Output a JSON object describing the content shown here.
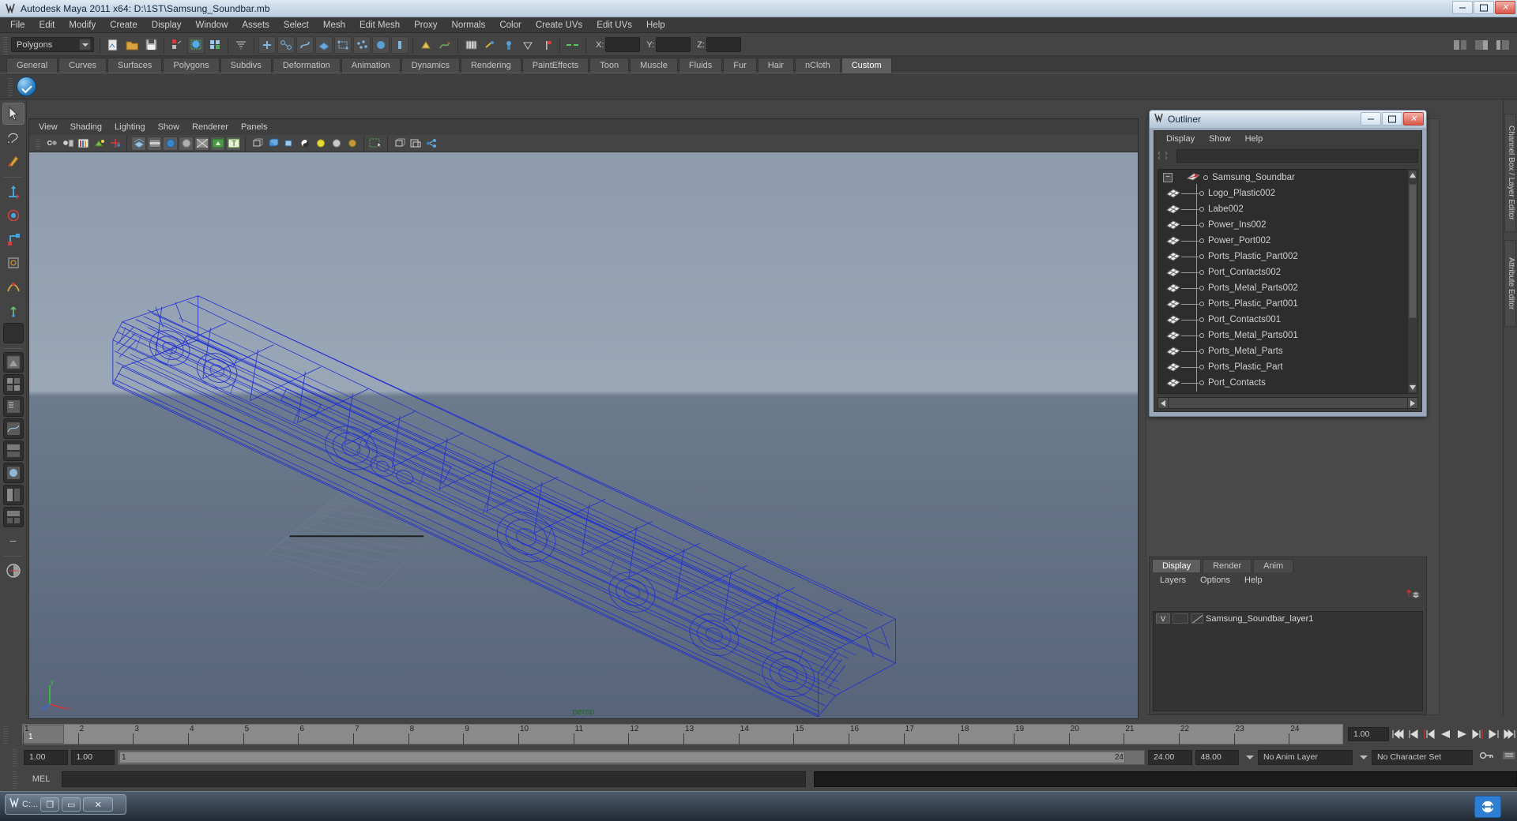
{
  "window": {
    "title": "Autodesk Maya 2011 x64: D:\\1ST\\Samsung_Soundbar.mb",
    "icon": "maya-icon",
    "minimize_label": "–",
    "maximize_label": "□",
    "close_label": "✕"
  },
  "menubar": {
    "items": [
      "File",
      "Edit",
      "Modify",
      "Create",
      "Display",
      "Window",
      "Assets",
      "Select",
      "Mesh",
      "Edit Mesh",
      "Proxy",
      "Normals",
      "Color",
      "Create UVs",
      "Edit UVs",
      "Help"
    ]
  },
  "statusline": {
    "mode_selector": "Polygons",
    "fields": {
      "x_label": "X:",
      "y_label": "Y:",
      "z_label": "Z:",
      "x_value": "",
      "y_value": "",
      "z_value": ""
    }
  },
  "shelf": {
    "tabs": [
      "General",
      "Curves",
      "Surfaces",
      "Polygons",
      "Subdivs",
      "Deformation",
      "Animation",
      "Dynamics",
      "Rendering",
      "PaintEffects",
      "Toon",
      "Muscle",
      "Fluids",
      "Fur",
      "Hair",
      "nCloth",
      "Custom"
    ],
    "active_tab": "Custom",
    "buttons": [
      {
        "name": "blue-check-shelf-button",
        "label": ""
      }
    ]
  },
  "viewport": {
    "menus": [
      "View",
      "Shading",
      "Lighting",
      "Show",
      "Renderer",
      "Panels"
    ],
    "camera_label": "persp",
    "axis": {
      "x": "x",
      "y": "y",
      "z": "z"
    },
    "model_color": "#1f2fd0",
    "background_top": "#8d9bad",
    "background_bottom": "#57647a"
  },
  "outliner": {
    "title": "Outliner",
    "menus": [
      "Display",
      "Show",
      "Help"
    ],
    "search_value": "",
    "root": {
      "label": "Samsung_Soundbar",
      "expanded": true,
      "expander": "−"
    },
    "items": [
      "Logo_Plastic002",
      "Labe002",
      "Power_Ins002",
      "Power_Port002",
      "Ports_Plastic_Part002",
      "Port_Contacts002",
      "Ports_Metal_Parts002",
      "Ports_Plastic_Part001",
      "Port_Contacts001",
      "Ports_Metal_Parts001",
      "Ports_Metal_Parts",
      "Ports_Plastic_Part",
      "Port_Contacts"
    ]
  },
  "right_rail": {
    "tabs": [
      "Channel Box / Layer Editor",
      "Attribute Editor"
    ]
  },
  "layer_editor": {
    "tabs": [
      "Display",
      "Render",
      "Anim"
    ],
    "active_tab": "Display",
    "menus": [
      "Layers",
      "Options",
      "Help"
    ],
    "layers": [
      {
        "visibility": "V",
        "name": "Samsung_Soundbar_layer1"
      }
    ]
  },
  "timeline": {
    "ticks": [
      "1",
      "2",
      "3",
      "4",
      "5",
      "6",
      "7",
      "8",
      "9",
      "10",
      "11",
      "12",
      "13",
      "14",
      "15",
      "16",
      "17",
      "18",
      "19",
      "20",
      "21",
      "22",
      "23",
      "24"
    ],
    "current_frame_marker": "1",
    "current_frame_field": "1.00",
    "playback_buttons": [
      "go-to-start",
      "step-back-key",
      "step-back-frame",
      "play-backwards",
      "play-forwards",
      "step-forward-frame",
      "step-forward-key",
      "go-to-end"
    ]
  },
  "range_slider": {
    "anim_start": "1.00",
    "range_start": "1.00",
    "bar_start_label": "1",
    "bar_end_label": "24",
    "range_end": "24.00",
    "anim_end": "48.00",
    "anim_layer": "No Anim Layer",
    "character_set": "No Character Set"
  },
  "command_line": {
    "language_label": "MEL",
    "input_value": "",
    "output_value": ""
  },
  "taskbar": {
    "item_label": "C:...",
    "buttons": [
      "restore",
      "maximize",
      "close"
    ],
    "restore_glyph": "❐",
    "maximize_glyph": "▭",
    "close_glyph": "✕"
  }
}
